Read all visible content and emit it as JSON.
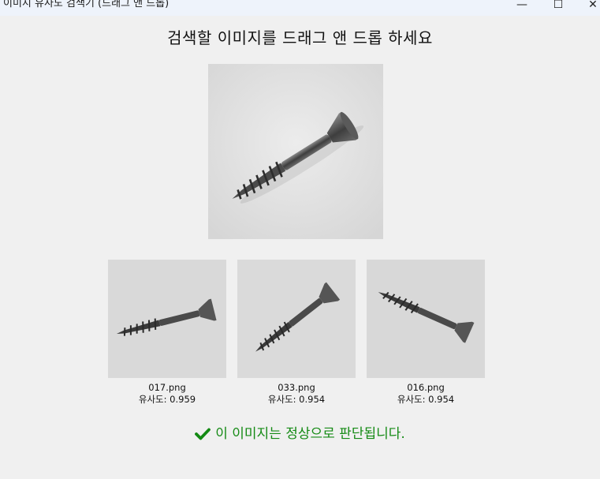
{
  "window": {
    "title": "이미지 유사도 검색기 (드래그 앤 드롭)",
    "minimize_glyph": "—",
    "maximize_glyph": "☐",
    "close_glyph": "✕"
  },
  "heading": "검색할 이미지를 드래그 앤 드롭 하세요",
  "query_image": {
    "icon": "screw-image"
  },
  "results": [
    {
      "filename": "017.png",
      "similarity_text": "유사도: 0.959",
      "similarity": 0.959
    },
    {
      "filename": "033.png",
      "similarity_text": "유사도: 0.954",
      "similarity": 0.954
    },
    {
      "filename": "016.png",
      "similarity_text": "유사도: 0.954",
      "similarity": 0.954
    }
  ],
  "verdict": {
    "icon": "checkmark-icon",
    "text": "이 이미지는 정상으로 판단됩니다.",
    "color": "#148a14"
  }
}
